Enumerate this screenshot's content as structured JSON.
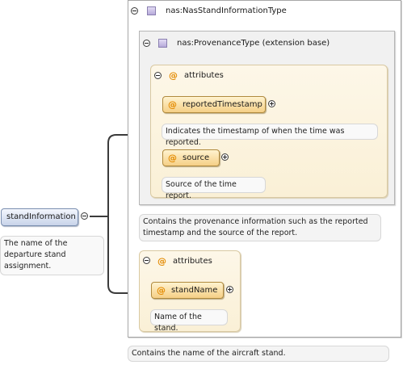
{
  "stand_type": {
    "name": "nas:NasStandInformationType",
    "description": "Contains the name of the aircraft stand."
  },
  "provenance": {
    "name": "nas:ProvenanceType (extension base)",
    "description": "Contains the provenance information such as the reported timestamp and the source of the report.",
    "attributes_label": "attributes",
    "attributes": [
      {
        "name": "reportedTimestamp",
        "description": "Indicates the timestamp of when the time was reported."
      },
      {
        "name": "source",
        "description": "Source of the time report."
      }
    ]
  },
  "stand_attributes": {
    "label": "attributes",
    "items": [
      {
        "name": "standName",
        "description": "Name of the stand."
      }
    ]
  },
  "root_element": {
    "name": "standInformation",
    "description": "The name of the departure stand assignment."
  },
  "icons": {
    "collapse": "minus-circle-icon",
    "expand": "plus-circle-icon",
    "type": "complex-type-icon",
    "attribute": "attribute-at-icon"
  },
  "colors": {
    "attribute_fill": "#f5cf86",
    "element_fill": "#c9d4ea",
    "attribute_group_fill": "#faf0d6",
    "type_icon": "#b7aad9",
    "connector": "#3b3b3b"
  }
}
